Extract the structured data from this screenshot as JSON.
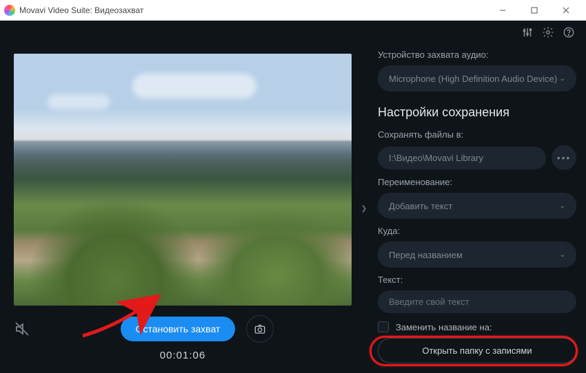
{
  "window": {
    "title": "Movavi Video Suite: Видеозахват"
  },
  "capture": {
    "stop_label": "Остановить захват",
    "timer": "00:01:06"
  },
  "panel": {
    "audio_device_label": "Устройство захвата аудио:",
    "audio_device_value": "Microphone (High Definition Audio Device)",
    "save_settings_title": "Настройки сохранения",
    "save_path_label": "Сохранять файлы в:",
    "save_path_value": "I:\\Видео\\Movavi Library",
    "rename_label": "Переименование:",
    "rename_value": "Добавить текст",
    "where_label": "Куда:",
    "where_value": "Перед названием",
    "text_label": "Текст:",
    "text_placeholder": "Введите свой текст",
    "replace_checkbox_label": "Заменить название на:",
    "open_folder_label": "Открыть папку с записями"
  }
}
